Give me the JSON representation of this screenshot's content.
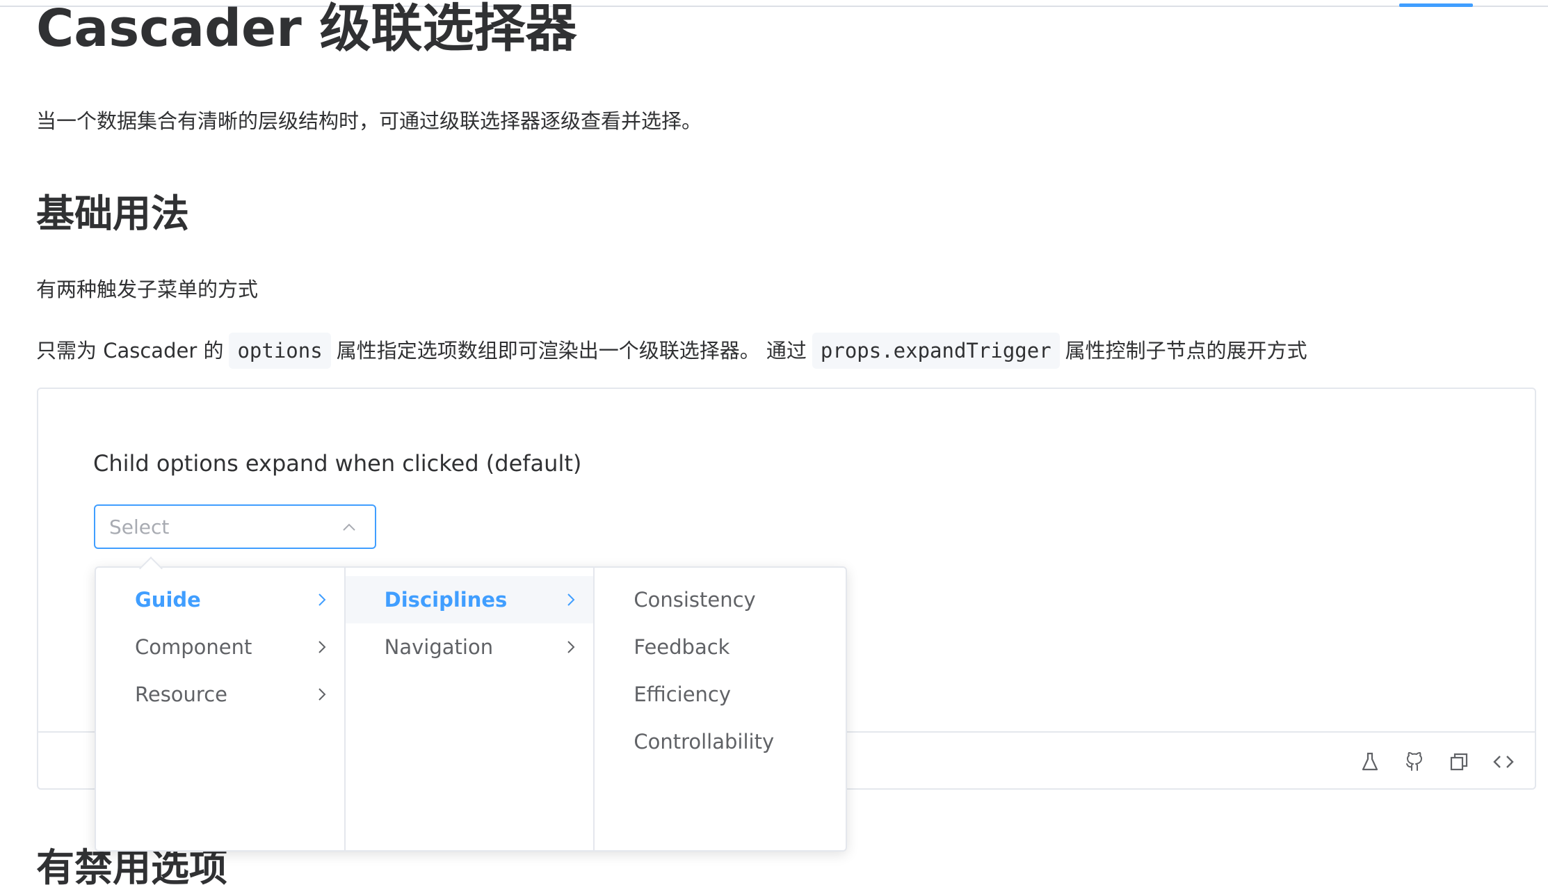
{
  "header": {
    "title": "Cascader 级联选择器",
    "intro": "当一个数据集合有清晰的层级结构时，可通过级联选择器逐级查看并选择。"
  },
  "basic_section": {
    "heading": "基础用法",
    "subtitle": "有两种触发子菜单的方式",
    "desc_part1": "只需为 Cascader 的",
    "code1": "options",
    "desc_part2": "属性指定选项数组即可渲染出一个级联选择器。 通过",
    "code2": "props.expandTrigger",
    "desc_part3": "属性控制子节点的展开方式"
  },
  "demo": {
    "label": "Child options expand when clicked (default)",
    "select_placeholder": "Select",
    "footer_icons": [
      "flask-icon",
      "github-icon",
      "copy-icon",
      "code-icon"
    ]
  },
  "cascader": {
    "menus": [
      [
        {
          "label": "Guide",
          "active": true,
          "has_children": true
        },
        {
          "label": "Component",
          "active": false,
          "has_children": true
        },
        {
          "label": "Resource",
          "active": false,
          "has_children": true
        }
      ],
      [
        {
          "label": "Disciplines",
          "active": true,
          "has_children": true
        },
        {
          "label": "Navigation",
          "active": false,
          "has_children": true
        }
      ],
      [
        {
          "label": "Consistency",
          "active": false,
          "has_children": false
        },
        {
          "label": "Feedback",
          "active": false,
          "has_children": false
        },
        {
          "label": "Efficiency",
          "active": false,
          "has_children": false
        },
        {
          "label": "Controllability",
          "active": false,
          "has_children": false
        }
      ]
    ]
  },
  "next_section": {
    "heading": "有禁用选项"
  },
  "colors": {
    "accent": "#409eff",
    "border": "#e4e7ed",
    "text": "#303133",
    "muted": "#606266"
  }
}
